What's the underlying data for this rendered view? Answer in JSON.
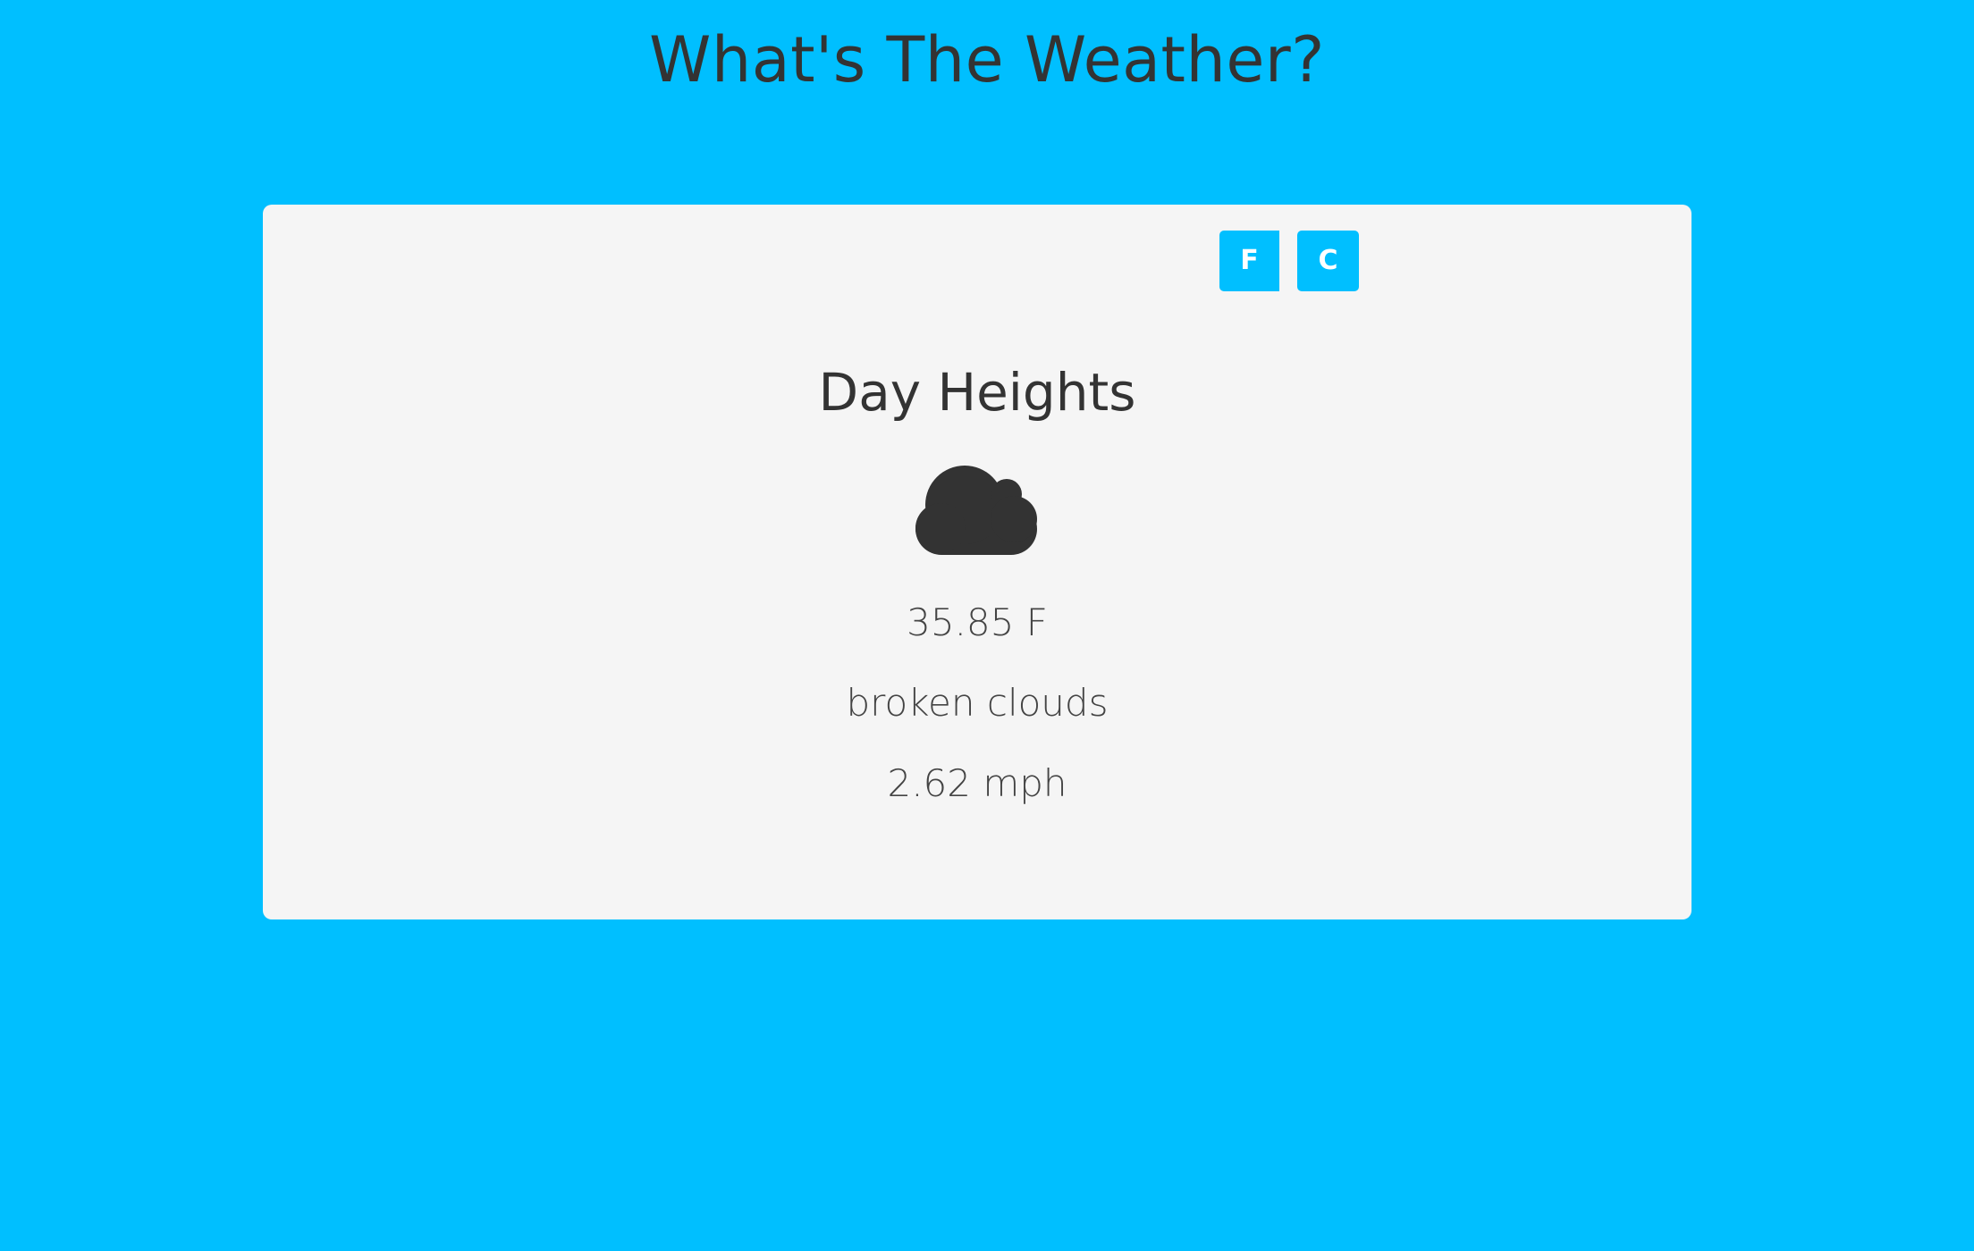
{
  "header": {
    "title": "What's The Weather?"
  },
  "card": {
    "unit_buttons": {
      "fahrenheit_label": "F",
      "celsius_label": "C"
    },
    "location": "Day Heights",
    "icon": "cloud-icon",
    "temperature": "35.85 F",
    "description": "broken clouds",
    "wind_speed": "2.62 mph"
  },
  "colors": {
    "background": "#00bfff",
    "card": "#f5f5f5",
    "text": "#333333",
    "button": "#00bfff",
    "button_text": "#ffffff"
  }
}
